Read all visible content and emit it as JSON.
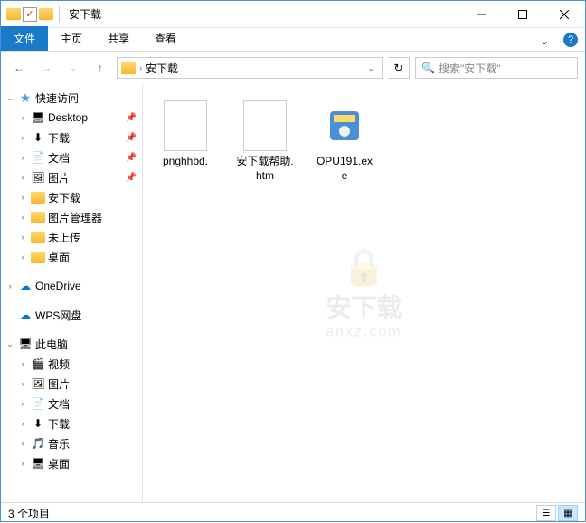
{
  "titlebar": {
    "title": "安下载"
  },
  "ribbon": {
    "file": "文件",
    "home": "主页",
    "share": "共享",
    "view": "查看"
  },
  "address": {
    "segment": "安下载"
  },
  "search": {
    "placeholder": "搜索\"安下载\""
  },
  "sidebar": {
    "quickaccess": "快速访问",
    "items": [
      {
        "label": "Desktop",
        "pinned": true,
        "icon": "desktop"
      },
      {
        "label": "下载",
        "pinned": true,
        "icon": "download"
      },
      {
        "label": "文档",
        "pinned": true,
        "icon": "document"
      },
      {
        "label": "图片",
        "pinned": true,
        "icon": "picture"
      },
      {
        "label": "安下载",
        "pinned": false,
        "icon": "folder"
      },
      {
        "label": "图片管理器",
        "pinned": false,
        "icon": "folder"
      },
      {
        "label": "未上传",
        "pinned": false,
        "icon": "folder"
      },
      {
        "label": "桌面",
        "pinned": false,
        "icon": "folder"
      }
    ],
    "onedrive": "OneDrive",
    "wps": "WPS网盘",
    "thispc": "此电脑",
    "pc_items": [
      {
        "label": "视频",
        "icon": "video"
      },
      {
        "label": "图片",
        "icon": "picture"
      },
      {
        "label": "文档",
        "icon": "document"
      },
      {
        "label": "下载",
        "icon": "download"
      },
      {
        "label": "音乐",
        "icon": "music"
      },
      {
        "label": "桌面",
        "icon": "desktop"
      }
    ]
  },
  "files": [
    {
      "name": "pnghhbd.",
      "type": "file"
    },
    {
      "name": "安下载帮助.htm",
      "type": "file"
    },
    {
      "name": "OPU191.exe",
      "type": "exe"
    }
  ],
  "watermark": {
    "text": "安下载",
    "sub": "anxz.com"
  },
  "status": {
    "count": "3 个项目"
  }
}
